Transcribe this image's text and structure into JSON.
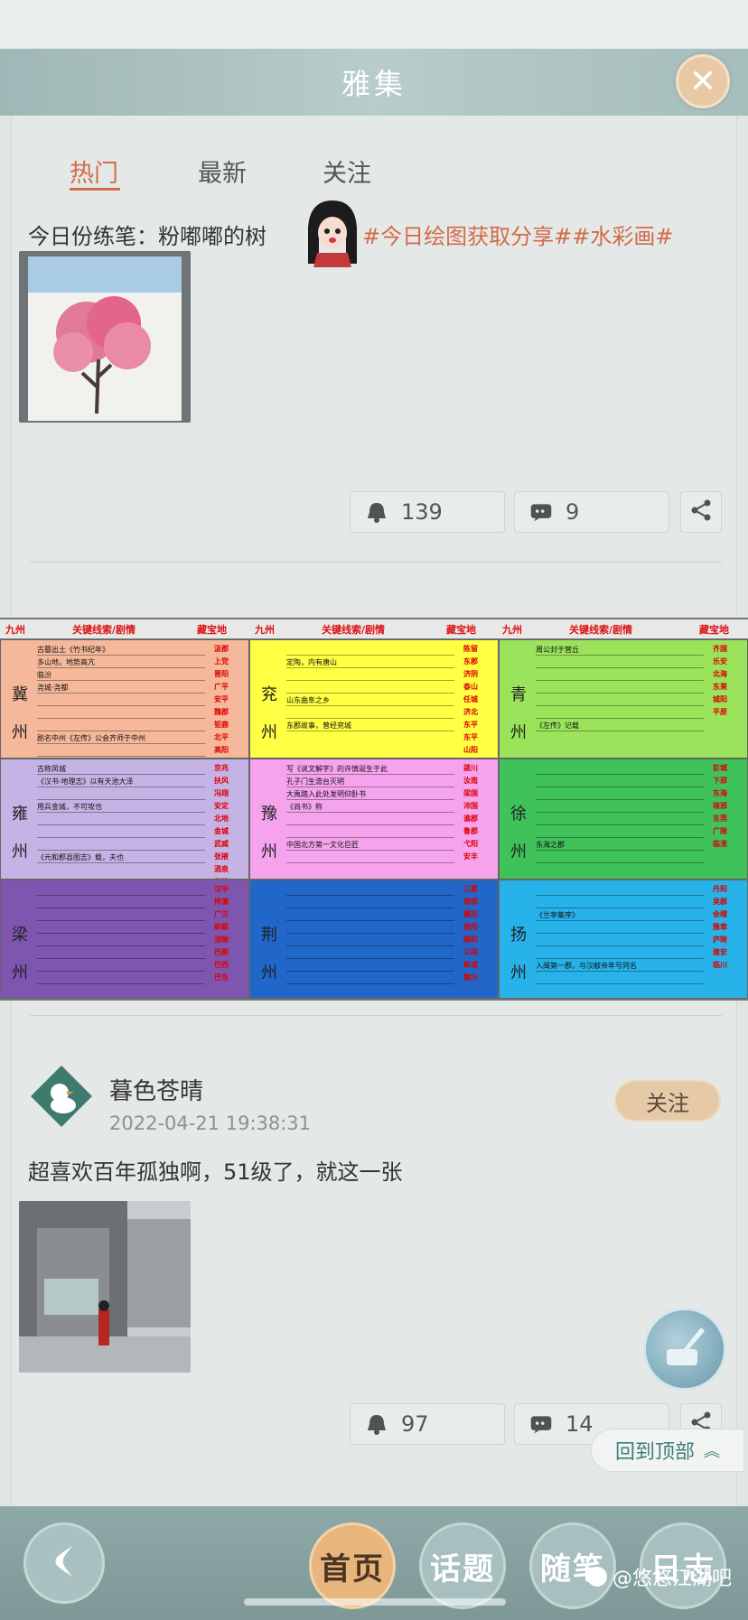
{
  "window": {
    "title": "雅集"
  },
  "tabs": [
    {
      "label": "热门",
      "active": true
    },
    {
      "label": "最新",
      "active": false
    },
    {
      "label": "关注",
      "active": false
    }
  ],
  "post1": {
    "text": "今日份练笔：粉嘟嘟的树",
    "hashtags": "#今日绘图获取分享##水彩画#",
    "likes": "139",
    "comments": "9"
  },
  "table": {
    "headers": [
      "九州",
      "关键线索/剧情",
      "藏宝地"
    ],
    "regions": [
      {
        "name": "冀\n州",
        "color": "#f5b89a",
        "rows": [
          "古墓出土《竹书纪年》",
          "多山地，地势高亢",
          "临汾",
          "尧城·尧都",
          "",
          "",
          "",
          "剧名中州《左传》公会齐师于中州",
          ""
        ],
        "cities": [
          "汲郡",
          "上党",
          "晋阳",
          "广平",
          "安平",
          "魏郡",
          "钜鹿",
          "北平",
          "高阳"
        ]
      },
      {
        "name": "兖\n州",
        "color": "#ffff44",
        "rows": [
          "",
          "定陶，内有唐山",
          "",
          "",
          "山东曲阜之乡",
          "",
          "东郡故事，曾经兖城"
        ],
        "cities": [
          "陈留",
          "东郡",
          "济阴",
          "泰山",
          "任城",
          "济北",
          "东平",
          "东平",
          "山阳"
        ]
      },
      {
        "name": "青\n州",
        "color": "#9be35a",
        "rows": [
          "周公封于营丘",
          "",
          "",
          "",
          "",
          "",
          "《左传》记载"
        ],
        "cities": [
          "齐国",
          "乐安",
          "北海",
          "东莱",
          "城阳",
          "平原"
        ]
      },
      {
        "name": "雍\n州",
        "color": "#c6b3e6",
        "rows": [
          "古称凤城",
          "《汉书·地理志》以有天池大泽",
          "",
          "用兵金城，不可攻也",
          "",
          "",
          "",
          "《元和郡县图志》载，夫也"
        ],
        "cities": [
          "京兆",
          "扶风",
          "冯翊",
          "安定",
          "北地",
          "金城",
          "武威",
          "张掖",
          "酒泉",
          "敦煌"
        ]
      },
      {
        "name": "豫\n州",
        "color": "#f6a3ee",
        "rows": [
          "写《说文解字》的许慎诞生于此",
          "孔子门生澹台灭明",
          "大禹踏入此处发明仰卧书",
          "《尚书》称",
          "",
          "",
          "中国北方第一文化巨匠",
          ""
        ],
        "cities": [
          "颍川",
          "汝南",
          "梁国",
          "沛国",
          "谯郡",
          "鲁郡",
          "弋阳",
          "安丰"
        ]
      },
      {
        "name": "徐\n州",
        "color": "#3fc25a",
        "rows": [
          "",
          "",
          "",
          "",
          "",
          "",
          "东海之郡",
          ""
        ],
        "cities": [
          "彭城",
          "下邳",
          "东海",
          "琅邪",
          "东莞",
          "广陵",
          "临淮"
        ]
      },
      {
        "name": "梁\n州",
        "color": "#7e56b0",
        "rows": [
          "",
          "",
          "",
          "",
          "",
          "",
          "",
          ""
        ],
        "cities": [
          "汉中",
          "梓潼",
          "广汉",
          "新都",
          "涪陵",
          "巴郡",
          "巴西",
          "巴东"
        ]
      },
      {
        "name": "荆\n州",
        "color": "#2167c9",
        "rows": [
          "",
          "",
          "",
          "",
          "",
          "",
          "",
          ""
        ],
        "cities": [
          "江夏",
          "南郡",
          "襄阳",
          "南阳",
          "顺阳",
          "义阳",
          "新城",
          "魏兴"
        ]
      },
      {
        "name": "扬\n州",
        "color": "#27b3ea",
        "rows": [
          "",
          "",
          "《兰亭集序》",
          "",
          "",
          "",
          "入闽第一郡，与汉献帝年号同名",
          ""
        ],
        "cities": [
          "丹阳",
          "吴郡",
          "会稽",
          "豫章",
          "庐陵",
          "建安",
          "临川"
        ]
      }
    ]
  },
  "post2": {
    "username": "暮色苍晴",
    "timestamp": "2022-04-21 19:38:31",
    "follow_label": "关注",
    "text": "超喜欢百年孤独啊，51级了，就这一张",
    "likes": "97",
    "comments": "14"
  },
  "back_to_top": "回到顶部",
  "bottom_nav": [
    {
      "label": "首页",
      "active": true
    },
    {
      "label": "话题",
      "active": false
    },
    {
      "label": "随笔",
      "active": false
    },
    {
      "label": "日志",
      "active": false
    }
  ],
  "watermark": "@悠悠江湖吧",
  "colors": {
    "accent": "#d36a49",
    "title_bar": "#a5bdbc",
    "follow": "#e6c9a7"
  }
}
